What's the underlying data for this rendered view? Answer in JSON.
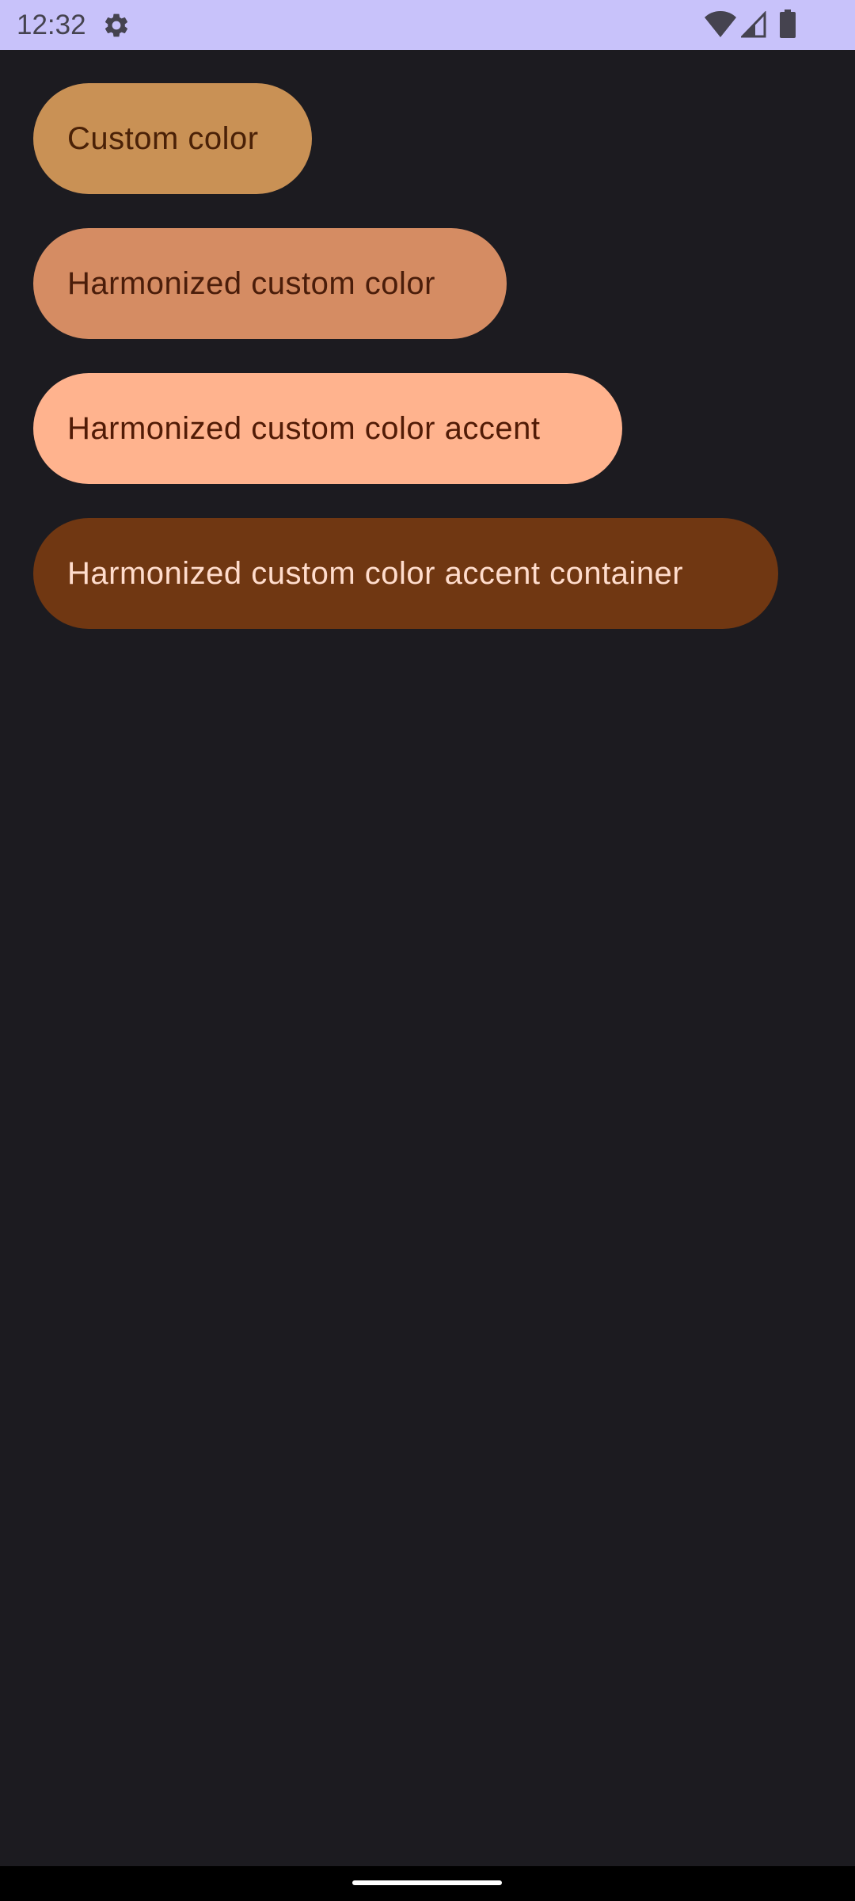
{
  "status_bar": {
    "time": "12:32",
    "icons": [
      "gear-icon",
      "wifi-icon",
      "cell-signal-icon",
      "battery-icon"
    ],
    "background": "#c8c2fa",
    "foreground": "#45434f"
  },
  "buttons": [
    {
      "label": "Custom color",
      "background": "#c99155",
      "text_color": "#4a2107"
    },
    {
      "label": "Harmonized custom color",
      "background": "#d58c63",
      "text_color": "#4a1d0a"
    },
    {
      "label": "Harmonized custom color accent",
      "background": "#ffb38e",
      "text_color": "#511b06"
    },
    {
      "label": "Harmonized custom color accent container",
      "background": "#703712",
      "text_color": "#ffdccc"
    }
  ],
  "theme": {
    "background": "#1c1b20",
    "nav_bar": "#000000"
  }
}
